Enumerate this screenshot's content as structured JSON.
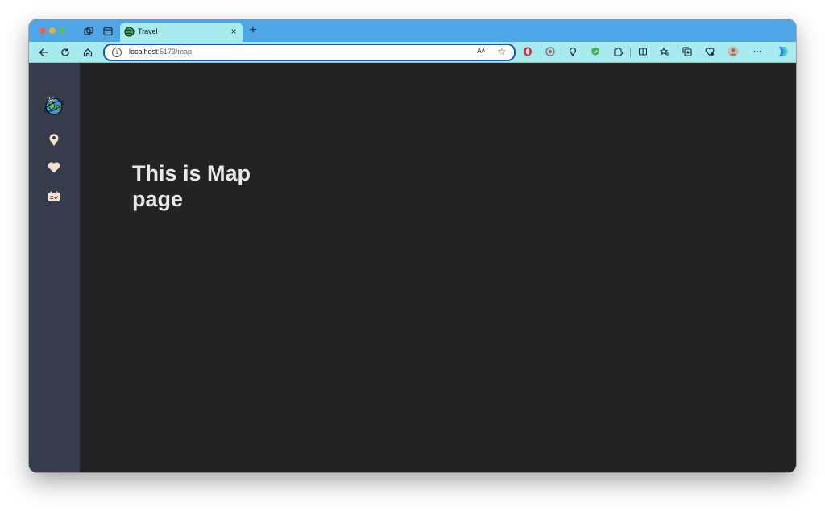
{
  "browser": {
    "tabs": [
      {
        "title": "Travel",
        "active": true
      }
    ],
    "address": {
      "host": "localhost",
      "path": ":5173/map"
    },
    "reader_label": "Aᴬ"
  },
  "sidebar": {
    "items": [
      {
        "icon": "travel-globe-logo-icon"
      },
      {
        "icon": "map-pin-icon"
      },
      {
        "icon": "heart-icon"
      },
      {
        "icon": "calendar-check-icon"
      }
    ]
  },
  "page": {
    "heading": "This is Map page"
  },
  "colors": {
    "tab_strip": "#4ea6e6",
    "toolbar": "#a7ebee",
    "page_background": "#232323",
    "sidebar_background": "#363c4b",
    "sidebar_icon": "#f6e0cc",
    "heading_text": "#e9e9e9"
  }
}
